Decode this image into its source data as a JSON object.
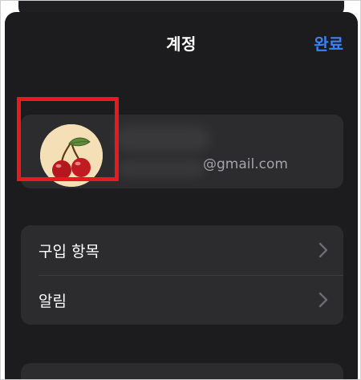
{
  "header": {
    "title": "계정",
    "done_label": "완료"
  },
  "account": {
    "avatar_icon": "cherry-icon",
    "email_visible_suffix": "@gmail.com",
    "highlight_color": "#e8191f"
  },
  "list": {
    "items": [
      {
        "label": "구입 항목",
        "icon": "chevron-right-icon"
      },
      {
        "label": "알림",
        "icon": "chevron-right-icon"
      }
    ]
  },
  "colors": {
    "background": "#1c1c1e",
    "card": "#2c2c2e",
    "accent": "#3b82f6",
    "text": "#ffffff",
    "secondary_text": "#a4a4a8"
  }
}
